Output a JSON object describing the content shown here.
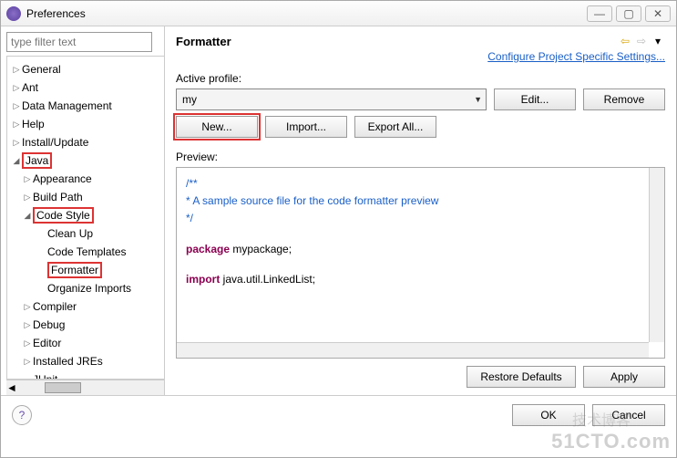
{
  "window": {
    "title": "Preferences"
  },
  "sidebar": {
    "filter_placeholder": "type filter text",
    "items": {
      "general": "General",
      "ant": "Ant",
      "data_mgmt": "Data Management",
      "help": "Help",
      "install_update": "Install/Update",
      "java": "Java",
      "appearance": "Appearance",
      "build_path": "Build Path",
      "code_style": "Code Style",
      "clean_up": "Clean Up",
      "code_templates": "Code Templates",
      "formatter": "Formatter",
      "organize_imports": "Organize Imports",
      "compiler": "Compiler",
      "debug": "Debug",
      "editor": "Editor",
      "installed_jres": "Installed JREs",
      "junit": "JUnit"
    }
  },
  "main": {
    "heading": "Formatter",
    "config_link": "Configure Project Specific Settings...",
    "active_profile_label": "Active profile:",
    "active_profile_value": "my",
    "edit": "Edit...",
    "remove": "Remove",
    "new": "New...",
    "import": "Import...",
    "export_all": "Export All...",
    "preview_label": "Preview:",
    "preview": {
      "l1": "/**",
      "l2": "* A sample source file for the code formatter preview",
      "l3": "*/",
      "l4a": "package",
      "l4b": " mypackage;",
      "l5a": "import",
      "l5b": " java.util.LinkedList;"
    },
    "restore_defaults": "Restore Defaults",
    "apply": "Apply"
  },
  "footer": {
    "ok": "OK",
    "cancel": "Cancel"
  },
  "watermark": "51CTO.com",
  "watermark2": "技术博客"
}
